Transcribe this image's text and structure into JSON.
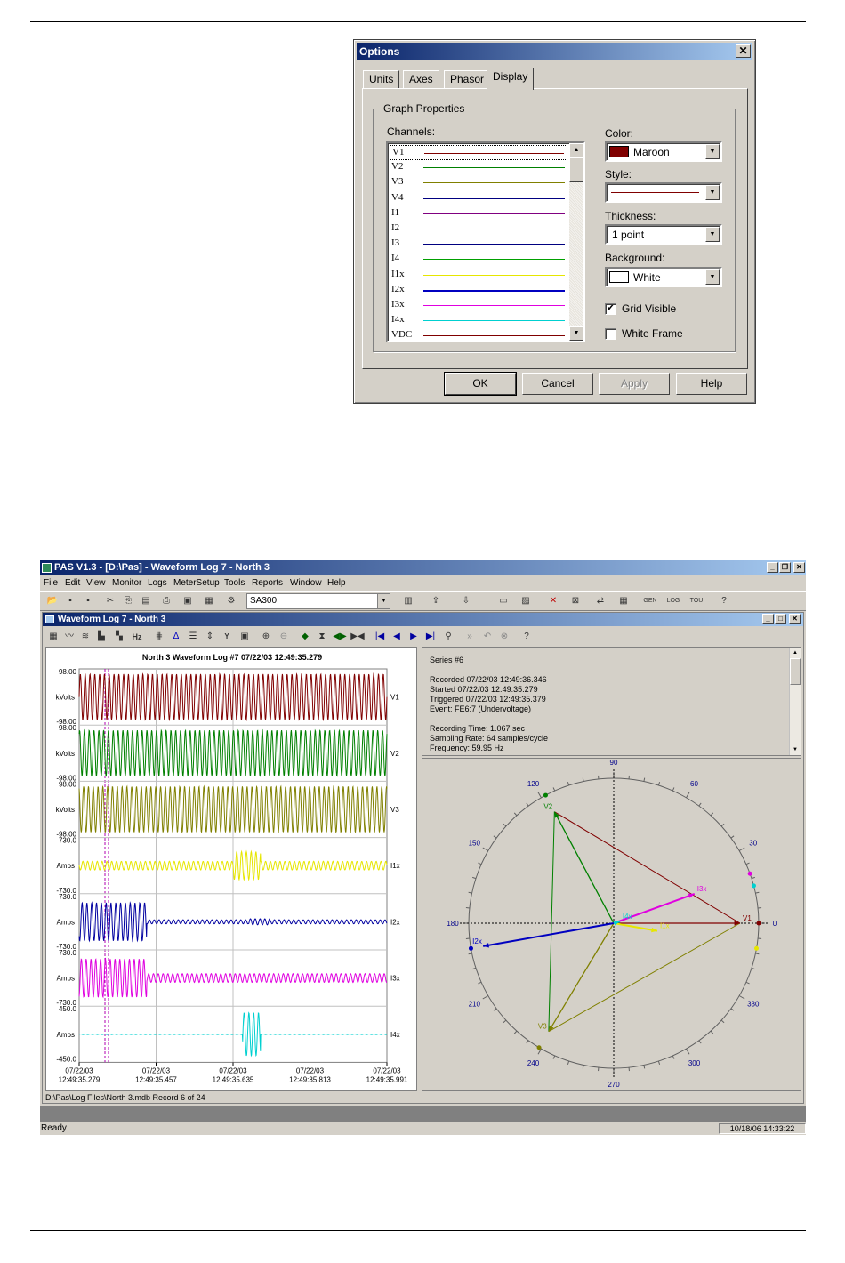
{
  "options_dialog": {
    "title": "Options",
    "tabs": [
      "Units",
      "Axes",
      "Phasor",
      "Display"
    ],
    "active_tab": "Display",
    "group_title": "Graph Properties",
    "channels_label": "Channels:",
    "channels": [
      {
        "name": "V1",
        "color": "#800000"
      },
      {
        "name": "V2",
        "color": "#008000"
      },
      {
        "name": "V3",
        "color": "#808000"
      },
      {
        "name": "V4",
        "color": "#000080"
      },
      {
        "name": "I1",
        "color": "#800080"
      },
      {
        "name": "I2",
        "color": "#008080"
      },
      {
        "name": "I3",
        "color": "#000080"
      },
      {
        "name": "I4",
        "color": "#00a000"
      },
      {
        "name": "I1x",
        "color": "#e6e600"
      },
      {
        "name": "I2x",
        "color": "#0000c0"
      },
      {
        "name": "I3x",
        "color": "#e000e0"
      },
      {
        "name": "I4x",
        "color": "#00d0d0"
      },
      {
        "name": "VDC",
        "color": "#800000"
      }
    ],
    "color_label": "Color:",
    "color_value": "Maroon",
    "color_swatch": "#800000",
    "style_label": "Style:",
    "thickness_label": "Thickness:",
    "thickness_value": "1 point",
    "background_label": "Background:",
    "background_value": "White",
    "grid_visible_label": "Grid Visible",
    "grid_visible_checked": true,
    "white_frame_label": "White Frame",
    "white_frame_checked": false,
    "buttons": {
      "ok": "OK",
      "cancel": "Cancel",
      "apply": "Apply",
      "help": "Help"
    }
  },
  "pas": {
    "title": "PAS V1.3 - [D:\\Pas] - Waveform Log 7 - North 3",
    "menu": [
      "File",
      "Edit",
      "View",
      "Monitor",
      "Logs",
      "MeterSetup",
      "Tools",
      "Reports",
      "Window",
      "Help"
    ],
    "toolbar_combo": "SA300",
    "child_title": "Waveform Log 7 - North 3",
    "waveform": {
      "title": "North 3  Waveform Log #7  07/22/03  12:49:35.279",
      "channels": [
        {
          "name": "V1",
          "unit": "kVolts",
          "max": "98.00",
          "min": "-98.00",
          "color": "#800000"
        },
        {
          "name": "V2",
          "unit": "kVolts",
          "max": "98.00",
          "min": "-98.00",
          "color": "#008000"
        },
        {
          "name": "V3",
          "unit": "kVolts",
          "max": "98.00",
          "min": "-98.00",
          "color": "#808000"
        },
        {
          "name": "I1x",
          "unit": "Amps",
          "max": "730.0",
          "min": "-730.0",
          "color": "#e6e600"
        },
        {
          "name": "I2x",
          "unit": "Amps",
          "max": "730.0",
          "min": "-730.0",
          "color": "#0000a0"
        },
        {
          "name": "I3x",
          "unit": "Amps",
          "max": "730.0",
          "min": "-730.0",
          "color": "#e000e0"
        },
        {
          "name": "I4x",
          "unit": "Amps",
          "max": "450.0",
          "min": "-450.0",
          "color": "#00d0d0"
        }
      ],
      "x_ticks": [
        {
          "date": "07/22/03",
          "time": "12:49:35.279"
        },
        {
          "date": "07/22/03",
          "time": "12:49:35.457"
        },
        {
          "date": "07/22/03",
          "time": "12:49:35.635"
        },
        {
          "date": "07/22/03",
          "time": "12:49:35.813"
        },
        {
          "date": "07/22/03",
          "time": "12:49:35.991"
        }
      ]
    },
    "info": {
      "series": "Series #6",
      "recorded": "Recorded 07/22/03  12:49:36.346",
      "started": "Started     07/22/03  12:49:35.279",
      "triggered": "Triggered  07/22/03  12:49:35.379",
      "event": "Event: FE6:7 (Undervoltage)",
      "recording_time": "Recording Time: 1.067 sec",
      "sampling_rate": "Sampling Rate: 64 samples/cycle",
      "frequency": "Frequency: 59.95 Hz"
    },
    "phasor": {
      "angle_labels": [
        "90",
        "60",
        "30",
        "0",
        "330",
        "300",
        "270",
        "240",
        "210",
        "180",
        "150",
        "120"
      ],
      "vectors": [
        {
          "name": "V1",
          "angle": 0,
          "magnitude": 1.0,
          "color": "#800000"
        },
        {
          "name": "V2",
          "angle": 118,
          "magnitude": 1.0,
          "color": "#008000"
        },
        {
          "name": "V3",
          "angle": 239,
          "magnitude": 1.0,
          "color": "#808000"
        },
        {
          "name": "I1x",
          "angle": -10,
          "magnitude": 0.35,
          "color": "#e6e600"
        },
        {
          "name": "I2x",
          "angle": 190,
          "magnitude": 1.05,
          "color": "#0000c0"
        },
        {
          "name": "I3x",
          "angle": 20,
          "magnitude": 0.68,
          "color": "#e000e0"
        },
        {
          "name": "I4x",
          "angle": 15,
          "magnitude": 0.05,
          "color": "#00d0d0"
        }
      ]
    },
    "status_path": "D:\\Pas\\Log Files\\North 3.mdb  Record 6 of 24",
    "app_status": "Ready",
    "clock": "10/18/06 14:33:22"
  }
}
